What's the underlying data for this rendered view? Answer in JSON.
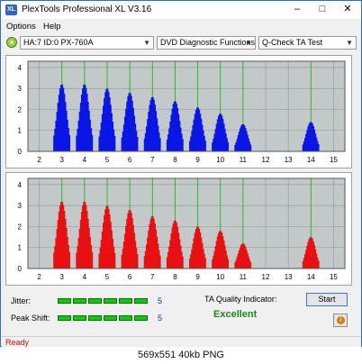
{
  "window": {
    "title": "PlexTools Professional XL V3.16",
    "icon_text": "XL",
    "controls": [
      "–",
      "□",
      "✕"
    ]
  },
  "menu": {
    "items": [
      "Options",
      "Help"
    ]
  },
  "toolbar": {
    "drive": "HA:7 ID:0  PX-760A",
    "function": "DVD Diagnostic Functions",
    "test": "Q-Check TA Test"
  },
  "charts": {
    "y_ticks": [
      "0",
      "1",
      "2",
      "3",
      "4"
    ],
    "x_ticks": [
      "2",
      "3",
      "4",
      "5",
      "6",
      "7",
      "8",
      "9",
      "10",
      "11",
      "12",
      "13",
      "14",
      "15"
    ]
  },
  "chart_data": [
    {
      "type": "area",
      "series": [
        {
          "color": "#0a16e6",
          "values_by_x_center": {
            "3": 3.2,
            "4": 3.2,
            "5": 3.0,
            "6": 2.8,
            "7": 2.6,
            "8": 2.4,
            "9": 2.1,
            "10": 1.8,
            "11": 1.3,
            "14": 1.4
          }
        }
      ],
      "xlim": [
        1.5,
        15.5
      ],
      "ylim": [
        0,
        4.3
      ],
      "grid": true
    },
    {
      "type": "area",
      "series": [
        {
          "color": "#e81010",
          "values_by_x_center": {
            "3": 3.2,
            "4": 3.2,
            "5": 3.0,
            "6": 2.8,
            "7": 2.5,
            "8": 2.3,
            "9": 2.0,
            "10": 1.8,
            "11": 1.2,
            "14": 1.5
          }
        }
      ],
      "xlim": [
        1.5,
        15.5
      ],
      "ylim": [
        0,
        4.3
      ],
      "grid": true
    }
  ],
  "metrics": {
    "jitter_label": "Jitter:",
    "jitter_value": "5",
    "peak_label": "Peak Shift:",
    "peak_value": "5",
    "ta_label": "TA Quality Indicator:",
    "ta_result": "Excellent",
    "led_color": "#11c911"
  },
  "buttons": {
    "start": "Start",
    "info": "i"
  },
  "status": {
    "text": "Ready"
  },
  "caption": "569x551  40kb  PNG"
}
